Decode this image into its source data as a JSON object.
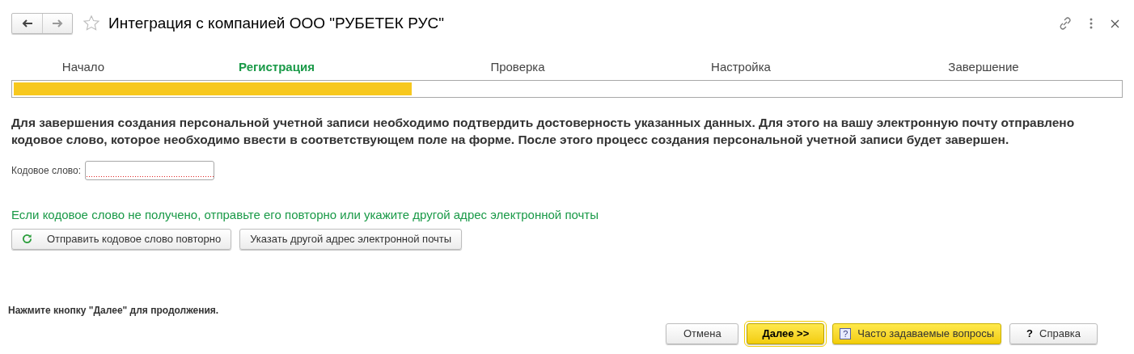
{
  "window": {
    "title": "Интеграция с компанией ООО \"РУБЕТЕК РУС\""
  },
  "steps": [
    {
      "label": "Начало",
      "selected": false
    },
    {
      "label": "Регистрация",
      "selected": true
    },
    {
      "label": "Проверка",
      "selected": false
    },
    {
      "label": "Настройка",
      "selected": false
    },
    {
      "label": "Завершение",
      "selected": false
    }
  ],
  "progress": {
    "level": 0.36
  },
  "message": "Для завершения создания персональной учетной записи необходимо подтвердить достоверность указанных данных. Для этого на вашу электронную почту отправлено кодовое слово, которое необходимо ввести в соответствующем поле на форме. После этого процесс создания персональной учетной записи будет завершен.",
  "code_field": {
    "label": "Кодовое слово:",
    "required": true
  },
  "resend_hint": "Если кодовое слово не получено, отправьте его повторно или укажите другой адрес электронной почты",
  "resend_buttons": [
    {
      "label": "Отправить кодовое слово повторно",
      "kind": "refresh"
    },
    {
      "label": "Указать другой адрес электронной почты",
      "kind": "plain"
    }
  ],
  "footer_hint": "Нажмите кнопку \"Далее\" для продолжения.",
  "buttons": [
    {
      "label": "Отмена",
      "kind": "default"
    },
    {
      "label": "Далее >>",
      "kind": "primary"
    },
    {
      "label": "Часто задаваемые вопросы",
      "kind": "yellow",
      "icon_text": "?"
    },
    {
      "label": "Справка",
      "kind": "default",
      "icon_text": "?"
    }
  ]
}
